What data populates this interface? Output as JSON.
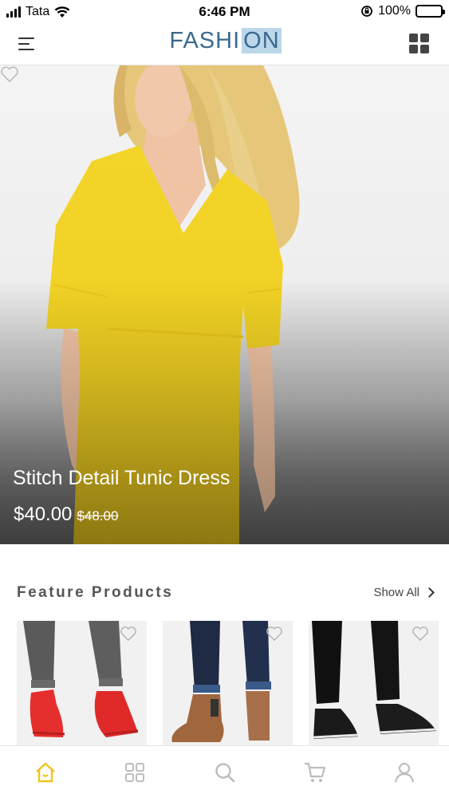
{
  "status_bar": {
    "carrier": "Tata",
    "time": "6:46 PM",
    "battery": "100%"
  },
  "header": {
    "title_part1": "FASHI",
    "title_part2": "ON",
    "title_part3": ""
  },
  "hero": {
    "product_name": "Stitch Detail Tunic Dress",
    "price": "$40.00",
    "old_price": "$48.00"
  },
  "feature": {
    "title": "Feature Products",
    "show_all": "Show All"
  },
  "tabs": [
    {
      "icon": "home-icon",
      "active": true
    },
    {
      "icon": "categories-icon",
      "active": false
    },
    {
      "icon": "search-icon",
      "active": false
    },
    {
      "icon": "cart-icon",
      "active": false
    },
    {
      "icon": "profile-icon",
      "active": false
    }
  ],
  "colors": {
    "brand": "#3c6a8e",
    "active_tab": "#f0c419",
    "inactive_tab": "#bdbdbd"
  }
}
